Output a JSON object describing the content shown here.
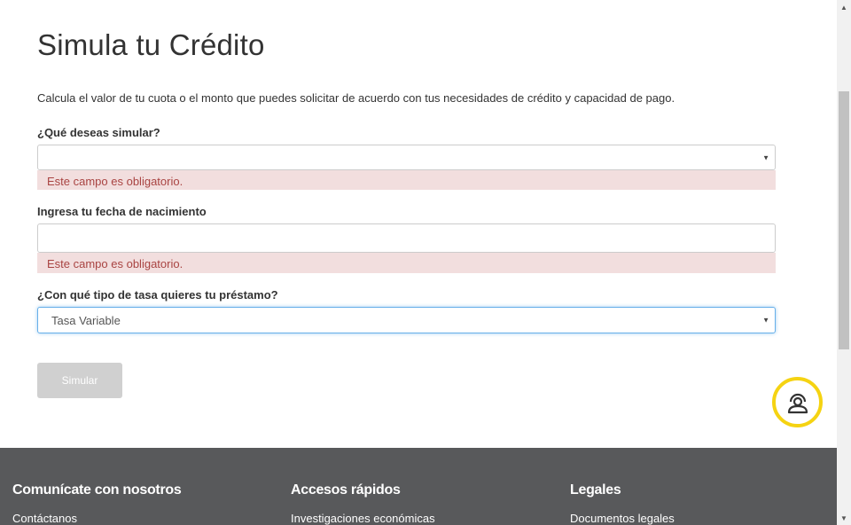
{
  "header": {
    "title": "Simula tu Crédito"
  },
  "intro": "Calcula el valor de tu cuota o el monto que puedes solicitar de acuerdo con tus necesidades de crédito y capacidad de pago.",
  "form": {
    "simulate_type": {
      "label": "¿Qué deseas simular?",
      "value": "",
      "error": "Este campo es obligatorio."
    },
    "birth_date": {
      "label": "Ingresa tu fecha de nacimiento",
      "value": "",
      "error": "Este campo es obligatorio."
    },
    "rate_type": {
      "label": "¿Con qué tipo de tasa quieres tu préstamo?",
      "value": "Tasa Variable"
    },
    "submit_label": "Simular"
  },
  "footer": {
    "columns": [
      {
        "heading": "Comunícate con nosotros",
        "link": "Contáctanos"
      },
      {
        "heading": "Accesos rápidos",
        "link": "Investigaciones económicas"
      },
      {
        "heading": "Legales",
        "link": "Documentos legales"
      }
    ]
  },
  "icons": {
    "help": "chat-support-icon",
    "select_caret": "caret-down-icon"
  },
  "colors": {
    "error_bg": "#f2dede",
    "error_text": "#a94442",
    "footer_bg": "#58595b",
    "help_ring": "#f5d312",
    "focus_border": "#66afe9"
  }
}
